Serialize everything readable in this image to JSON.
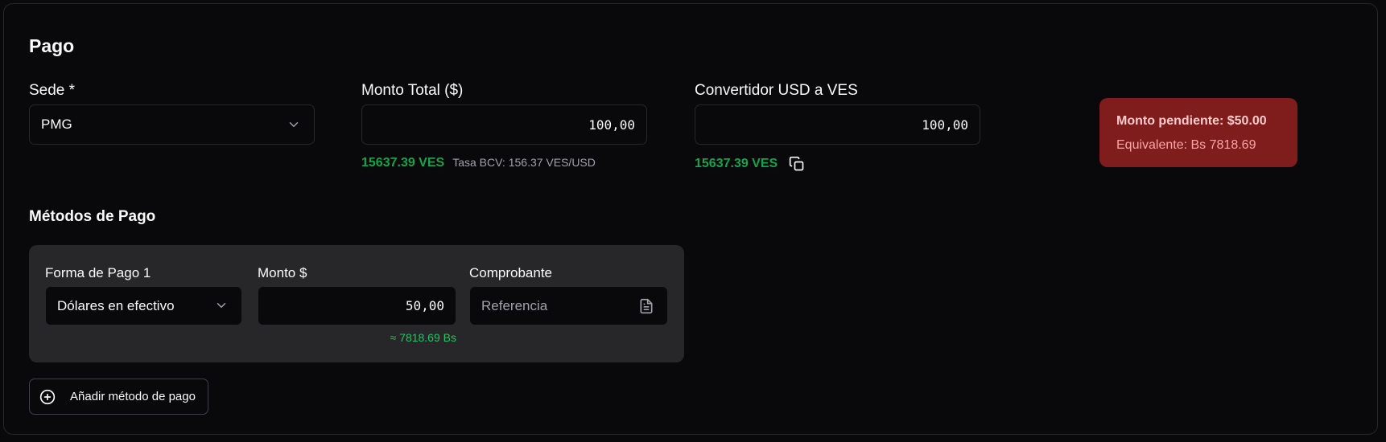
{
  "section": {
    "title": "Pago"
  },
  "sede": {
    "label": "Sede *",
    "value": "PMG",
    "icon": "chevron-down-icon"
  },
  "monto_total": {
    "label": "Monto Total ($)",
    "value": "100,00",
    "ves_amount": "15637.39 VES",
    "rate_text": "Tasa BCV: 156.37 VES/USD"
  },
  "convertidor": {
    "label": "Convertidor USD a VES",
    "value": "100,00",
    "ves_amount": "15637.39 VES",
    "icon": "copy-icon"
  },
  "pending": {
    "title": "Monto pendiente: $50.00",
    "equivalent": "Equivalente: Bs 7818.69",
    "bg_color": "#7f1d1d"
  },
  "methods": {
    "title": "Métodos de Pago",
    "items": [
      {
        "forma_label": "Forma de Pago 1",
        "forma_value": "Dólares en efectivo",
        "monto_label": "Monto $",
        "monto_value": "50,00",
        "monto_bs": "≈ 7818.69 Bs",
        "comprobante_label": "Comprobante",
        "comprobante_placeholder": "Referencia"
      }
    ],
    "add_label": "Añadir método de pago",
    "add_icon": "plus-circle-icon"
  },
  "colors": {
    "accent_green": "#16a34a",
    "panel": "#27272a",
    "background": "#09090b"
  }
}
